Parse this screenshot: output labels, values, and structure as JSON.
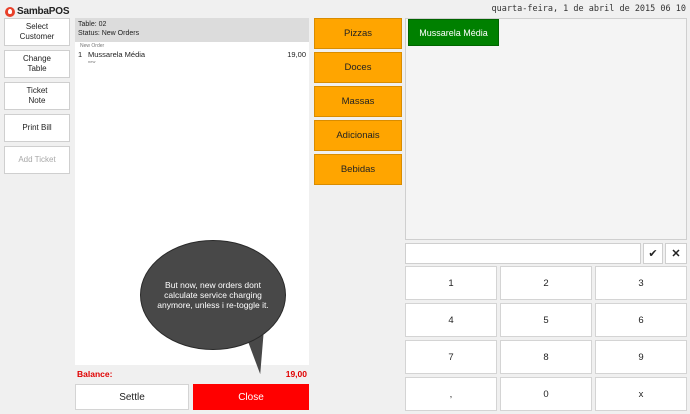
{
  "app": {
    "logo_text": "SambaPOS",
    "datetime": "quarta-feira, 1 de abril de 2015 06 10"
  },
  "left_buttons": [
    {
      "label": "Select\nCustomer",
      "disabled": false
    },
    {
      "label": "Change\nTable",
      "disabled": false
    },
    {
      "label": "Ticket\nNote",
      "disabled": false
    },
    {
      "label": "Print Bill",
      "disabled": false
    },
    {
      "label": "Add Ticket",
      "disabled": true
    }
  ],
  "ticket": {
    "table": "Table: 02",
    "status": "Status: New Orders",
    "order_tag": "New Order",
    "orders": [
      {
        "qty": "1",
        "name": "Mussarela Média",
        "price": "19,00",
        "sub": "new"
      }
    ],
    "balance_label": "Balance:",
    "balance_value": "19,00"
  },
  "callout": "But now, new orders dont calculate service charging anymore, unless i re-toggle it.",
  "actions": {
    "settle": "Settle",
    "close": "Close"
  },
  "categories": [
    "Pizzas",
    "Doces",
    "Massas",
    "Adicionais",
    "Bebidas"
  ],
  "menu_items": [
    "Mussarela Média"
  ],
  "numpad": {
    "check": "✔",
    "clear": "✕",
    "keys": [
      "1",
      "2",
      "3",
      "4",
      "5",
      "6",
      "7",
      "8",
      "9",
      ",",
      "0",
      "x"
    ]
  },
  "colors": {
    "category": "#ffa500",
    "menu_item": "#008000",
    "close": "#ff0000",
    "balance": "#e00000",
    "callout": "#484848"
  }
}
